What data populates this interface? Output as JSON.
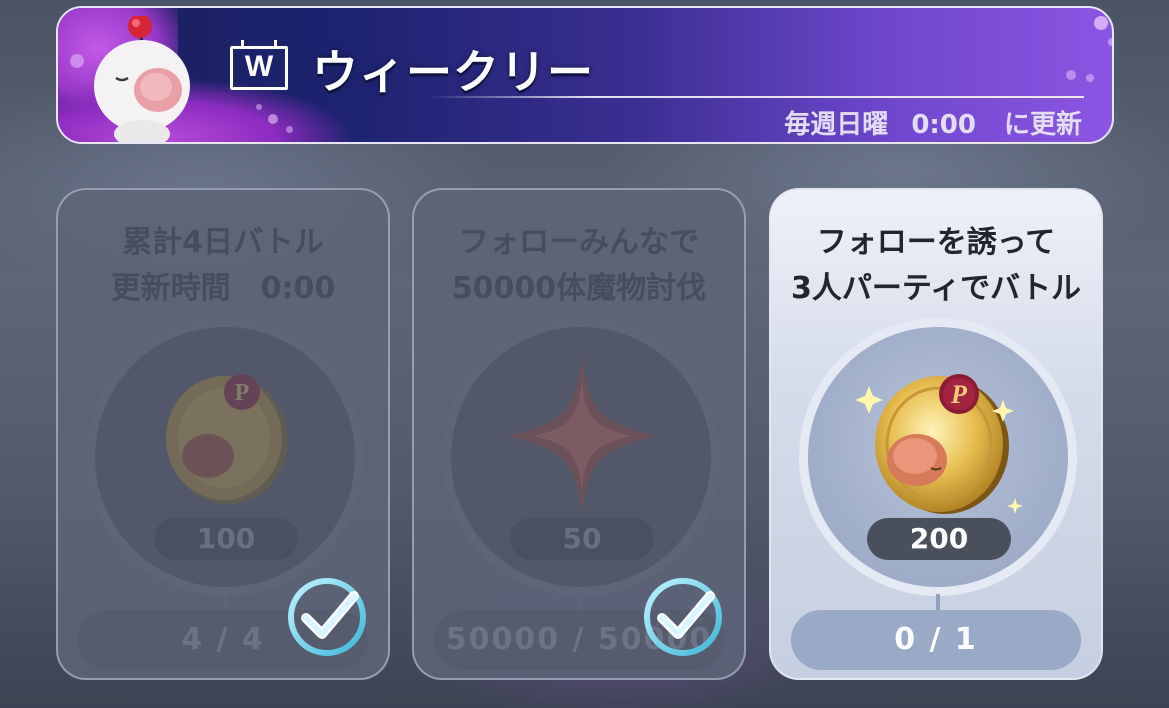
{
  "header": {
    "badge_letter": "W",
    "title": "ウィークリー",
    "subtitle_day": "毎週日曜",
    "subtitle_time": "0:00",
    "subtitle_suffix": "に更新"
  },
  "missions": [
    {
      "title": "累計4日バトル\n更新時間　0:00",
      "reward_icon": "moogle-coin-icon",
      "reward_count": "100",
      "progress": "4 / 4",
      "completed": true
    },
    {
      "title": "フォローみんなで\n50000体魔物討伐",
      "reward_icon": "star-crystal-icon",
      "reward_count": "50",
      "progress": "50000 / 50000",
      "completed": true
    },
    {
      "title": "フォローを誘って\n3人パーティでバトル",
      "reward_icon": "moogle-coin-icon",
      "reward_count": "200",
      "progress": "0 / 1",
      "completed": false
    }
  ],
  "colors": {
    "banner_start": "#1b1f5e",
    "banner_end": "#8b55e2",
    "check_accent": "#7fd8f0"
  }
}
